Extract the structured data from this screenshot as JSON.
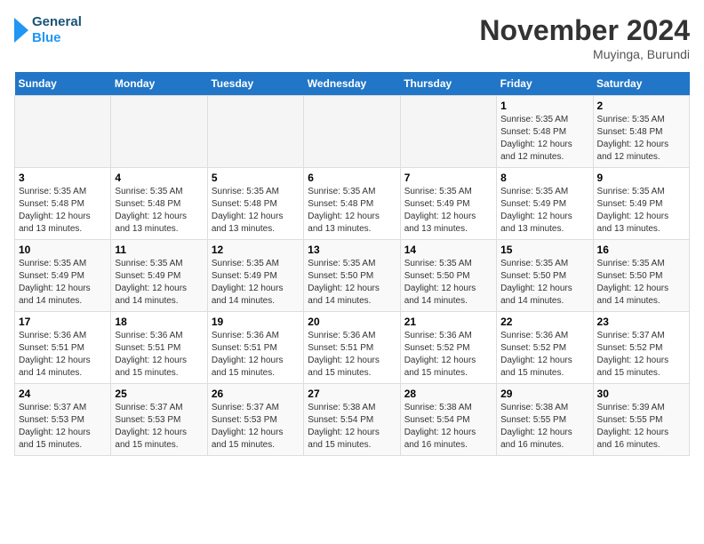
{
  "header": {
    "logo_line1": "General",
    "logo_line2": "Blue",
    "month": "November 2024",
    "location": "Muyinga, Burundi"
  },
  "weekdays": [
    "Sunday",
    "Monday",
    "Tuesday",
    "Wednesday",
    "Thursday",
    "Friday",
    "Saturday"
  ],
  "weeks": [
    [
      {
        "day": "",
        "sunrise": "",
        "sunset": "",
        "daylight": ""
      },
      {
        "day": "",
        "sunrise": "",
        "sunset": "",
        "daylight": ""
      },
      {
        "day": "",
        "sunrise": "",
        "sunset": "",
        "daylight": ""
      },
      {
        "day": "",
        "sunrise": "",
        "sunset": "",
        "daylight": ""
      },
      {
        "day": "",
        "sunrise": "",
        "sunset": "",
        "daylight": ""
      },
      {
        "day": "1",
        "sunrise": "Sunrise: 5:35 AM",
        "sunset": "Sunset: 5:48 PM",
        "daylight": "Daylight: 12 hours and 12 minutes."
      },
      {
        "day": "2",
        "sunrise": "Sunrise: 5:35 AM",
        "sunset": "Sunset: 5:48 PM",
        "daylight": "Daylight: 12 hours and 12 minutes."
      }
    ],
    [
      {
        "day": "3",
        "sunrise": "Sunrise: 5:35 AM",
        "sunset": "Sunset: 5:48 PM",
        "daylight": "Daylight: 12 hours and 13 minutes."
      },
      {
        "day": "4",
        "sunrise": "Sunrise: 5:35 AM",
        "sunset": "Sunset: 5:48 PM",
        "daylight": "Daylight: 12 hours and 13 minutes."
      },
      {
        "day": "5",
        "sunrise": "Sunrise: 5:35 AM",
        "sunset": "Sunset: 5:48 PM",
        "daylight": "Daylight: 12 hours and 13 minutes."
      },
      {
        "day": "6",
        "sunrise": "Sunrise: 5:35 AM",
        "sunset": "Sunset: 5:48 PM",
        "daylight": "Daylight: 12 hours and 13 minutes."
      },
      {
        "day": "7",
        "sunrise": "Sunrise: 5:35 AM",
        "sunset": "Sunset: 5:49 PM",
        "daylight": "Daylight: 12 hours and 13 minutes."
      },
      {
        "day": "8",
        "sunrise": "Sunrise: 5:35 AM",
        "sunset": "Sunset: 5:49 PM",
        "daylight": "Daylight: 12 hours and 13 minutes."
      },
      {
        "day": "9",
        "sunrise": "Sunrise: 5:35 AM",
        "sunset": "Sunset: 5:49 PM",
        "daylight": "Daylight: 12 hours and 13 minutes."
      }
    ],
    [
      {
        "day": "10",
        "sunrise": "Sunrise: 5:35 AM",
        "sunset": "Sunset: 5:49 PM",
        "daylight": "Daylight: 12 hours and 14 minutes."
      },
      {
        "day": "11",
        "sunrise": "Sunrise: 5:35 AM",
        "sunset": "Sunset: 5:49 PM",
        "daylight": "Daylight: 12 hours and 14 minutes."
      },
      {
        "day": "12",
        "sunrise": "Sunrise: 5:35 AM",
        "sunset": "Sunset: 5:49 PM",
        "daylight": "Daylight: 12 hours and 14 minutes."
      },
      {
        "day": "13",
        "sunrise": "Sunrise: 5:35 AM",
        "sunset": "Sunset: 5:50 PM",
        "daylight": "Daylight: 12 hours and 14 minutes."
      },
      {
        "day": "14",
        "sunrise": "Sunrise: 5:35 AM",
        "sunset": "Sunset: 5:50 PM",
        "daylight": "Daylight: 12 hours and 14 minutes."
      },
      {
        "day": "15",
        "sunrise": "Sunrise: 5:35 AM",
        "sunset": "Sunset: 5:50 PM",
        "daylight": "Daylight: 12 hours and 14 minutes."
      },
      {
        "day": "16",
        "sunrise": "Sunrise: 5:35 AM",
        "sunset": "Sunset: 5:50 PM",
        "daylight": "Daylight: 12 hours and 14 minutes."
      }
    ],
    [
      {
        "day": "17",
        "sunrise": "Sunrise: 5:36 AM",
        "sunset": "Sunset: 5:51 PM",
        "daylight": "Daylight: 12 hours and 14 minutes."
      },
      {
        "day": "18",
        "sunrise": "Sunrise: 5:36 AM",
        "sunset": "Sunset: 5:51 PM",
        "daylight": "Daylight: 12 hours and 15 minutes."
      },
      {
        "day": "19",
        "sunrise": "Sunrise: 5:36 AM",
        "sunset": "Sunset: 5:51 PM",
        "daylight": "Daylight: 12 hours and 15 minutes."
      },
      {
        "day": "20",
        "sunrise": "Sunrise: 5:36 AM",
        "sunset": "Sunset: 5:51 PM",
        "daylight": "Daylight: 12 hours and 15 minutes."
      },
      {
        "day": "21",
        "sunrise": "Sunrise: 5:36 AM",
        "sunset": "Sunset: 5:52 PM",
        "daylight": "Daylight: 12 hours and 15 minutes."
      },
      {
        "day": "22",
        "sunrise": "Sunrise: 5:36 AM",
        "sunset": "Sunset: 5:52 PM",
        "daylight": "Daylight: 12 hours and 15 minutes."
      },
      {
        "day": "23",
        "sunrise": "Sunrise: 5:37 AM",
        "sunset": "Sunset: 5:52 PM",
        "daylight": "Daylight: 12 hours and 15 minutes."
      }
    ],
    [
      {
        "day": "24",
        "sunrise": "Sunrise: 5:37 AM",
        "sunset": "Sunset: 5:53 PM",
        "daylight": "Daylight: 12 hours and 15 minutes."
      },
      {
        "day": "25",
        "sunrise": "Sunrise: 5:37 AM",
        "sunset": "Sunset: 5:53 PM",
        "daylight": "Daylight: 12 hours and 15 minutes."
      },
      {
        "day": "26",
        "sunrise": "Sunrise: 5:37 AM",
        "sunset": "Sunset: 5:53 PM",
        "daylight": "Daylight: 12 hours and 15 minutes."
      },
      {
        "day": "27",
        "sunrise": "Sunrise: 5:38 AM",
        "sunset": "Sunset: 5:54 PM",
        "daylight": "Daylight: 12 hours and 15 minutes."
      },
      {
        "day": "28",
        "sunrise": "Sunrise: 5:38 AM",
        "sunset": "Sunset: 5:54 PM",
        "daylight": "Daylight: 12 hours and 16 minutes."
      },
      {
        "day": "29",
        "sunrise": "Sunrise: 5:38 AM",
        "sunset": "Sunset: 5:55 PM",
        "daylight": "Daylight: 12 hours and 16 minutes."
      },
      {
        "day": "30",
        "sunrise": "Sunrise: 5:39 AM",
        "sunset": "Sunset: 5:55 PM",
        "daylight": "Daylight: 12 hours and 16 minutes."
      }
    ]
  ]
}
